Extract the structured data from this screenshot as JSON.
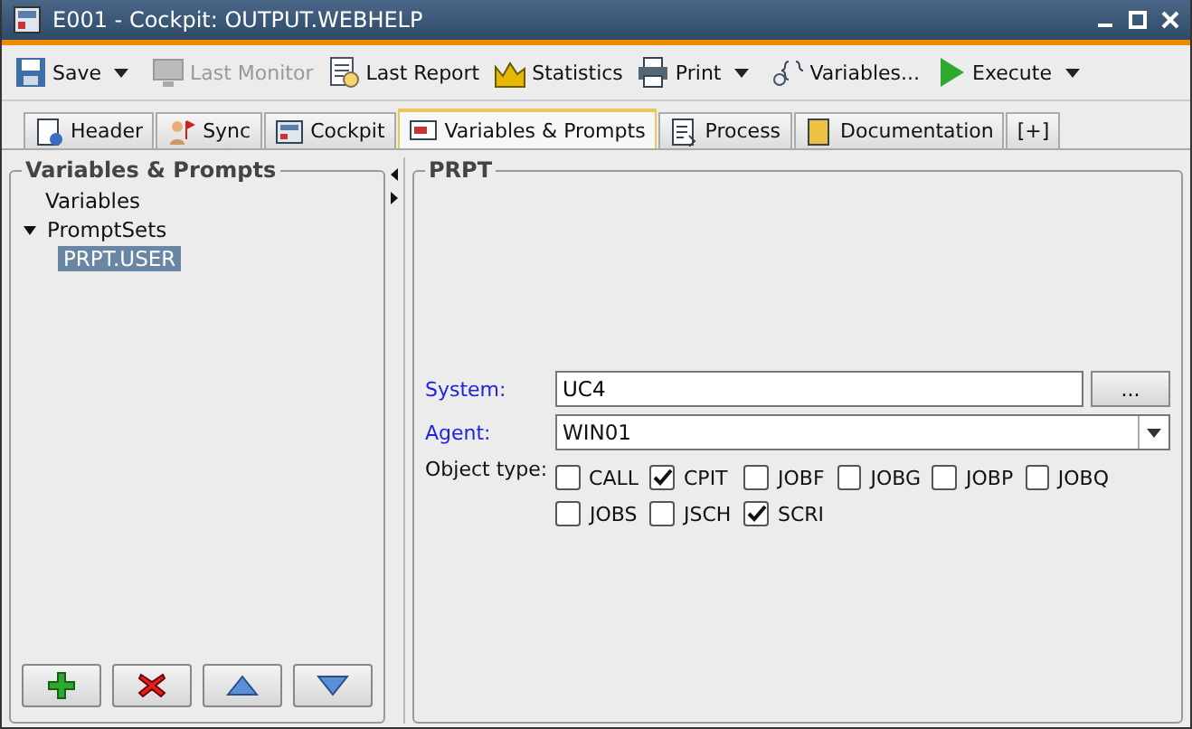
{
  "window": {
    "title": "E001 - Cockpit: OUTPUT.WEBHELP"
  },
  "toolbar": [
    {
      "kind": "save",
      "label": "Save",
      "dropdown": true,
      "disabled": false
    },
    {
      "kind": "monitor",
      "label": "Last Monitor",
      "dropdown": false,
      "disabled": true
    },
    {
      "kind": "report",
      "label": "Last Report",
      "dropdown": false,
      "disabled": false
    },
    {
      "kind": "stats",
      "label": "Statistics",
      "dropdown": false,
      "disabled": false
    },
    {
      "kind": "print",
      "label": "Print",
      "dropdown": true,
      "disabled": false
    },
    {
      "kind": "vars",
      "label": "Variables...",
      "dropdown": false,
      "disabled": false
    },
    {
      "kind": "execute",
      "label": "Execute",
      "dropdown": true,
      "disabled": false
    }
  ],
  "tabs": [
    {
      "kind": "header",
      "label": "Header",
      "selected": false
    },
    {
      "kind": "sync",
      "label": "Sync",
      "selected": false
    },
    {
      "kind": "cockpit",
      "label": "Cockpit",
      "selected": false
    },
    {
      "kind": "vars",
      "label": "Variables & Prompts",
      "selected": true
    },
    {
      "kind": "process",
      "label": "Process",
      "selected": false
    },
    {
      "kind": "doc",
      "label": "Documentation",
      "selected": false
    },
    {
      "kind": "plus",
      "label": "[+]",
      "selected": false
    }
  ],
  "left_panel": {
    "title": "Variables & Prompts",
    "tree": [
      {
        "label": "Variables",
        "selected": false
      },
      {
        "label": "PromptSets",
        "selected": false,
        "expanded": true,
        "children": [
          {
            "label": "PRPT.USER",
            "selected": true
          }
        ]
      }
    ],
    "buttons": [
      {
        "kind": "add"
      },
      {
        "kind": "delete"
      },
      {
        "kind": "up"
      },
      {
        "kind": "down"
      }
    ]
  },
  "right_panel": {
    "title": "PRPT",
    "system": {
      "label": "System:",
      "value": "UC4",
      "button": "..."
    },
    "agent": {
      "label": "Agent:",
      "value": "WIN01"
    },
    "object_type": {
      "label": "Object type:",
      "options": [
        {
          "label": "CALL",
          "checked": false
        },
        {
          "label": "CPIT",
          "checked": true
        },
        {
          "label": "JOBF",
          "checked": false
        },
        {
          "label": "JOBG",
          "checked": false
        },
        {
          "label": "JOBP",
          "checked": false
        },
        {
          "label": "JOBQ",
          "checked": false
        },
        {
          "label": "JOBS",
          "checked": false
        },
        {
          "label": "JSCH",
          "checked": false
        },
        {
          "label": "SCRI",
          "checked": true
        }
      ]
    }
  }
}
